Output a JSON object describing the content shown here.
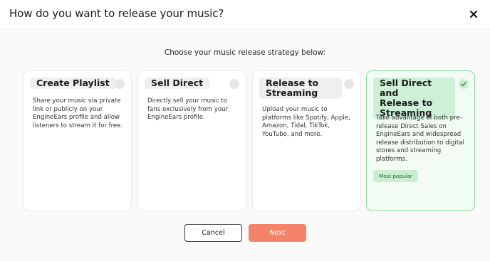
{
  "dialog": {
    "title": "How do you want to release your music?",
    "subtitle": "Choose your music release strategy below:"
  },
  "options": [
    {
      "title_lines": [
        "Create Playlist"
      ],
      "description": "Share your music via private link or publicly on your EngineEars profile and allow listeners to stream it for free.",
      "selected": false
    },
    {
      "title_lines": [
        "Sell Direct"
      ],
      "description": "Directly sell your music to fans exclusively from your EngineEars profile.",
      "selected": false
    },
    {
      "title_lines": [
        "Release to",
        "Streaming"
      ],
      "description": "Upload your music to platforms like Spotify, Apple, Amazon, Tidal, TikTok, YouTube, and more.",
      "selected": false
    },
    {
      "title_lines": [
        "Sell Direct and",
        "Release to",
        "Streaming"
      ],
      "description": "Take advantage of both pre-release Direct Sales on EngineEars and widespread release distribution to digital stores and streaming platforms.",
      "badge": "Most popular",
      "selected": true
    }
  ],
  "actions": {
    "cancel_label": "Cancel",
    "next_label": "Next"
  },
  "colors": {
    "accent": "#f5836a",
    "selected_border": "#8ad9a1",
    "selected_bg": "#f3fcf4",
    "check_green": "#2e9a52"
  },
  "icons": {
    "close": "close-icon",
    "check": "check-icon"
  }
}
